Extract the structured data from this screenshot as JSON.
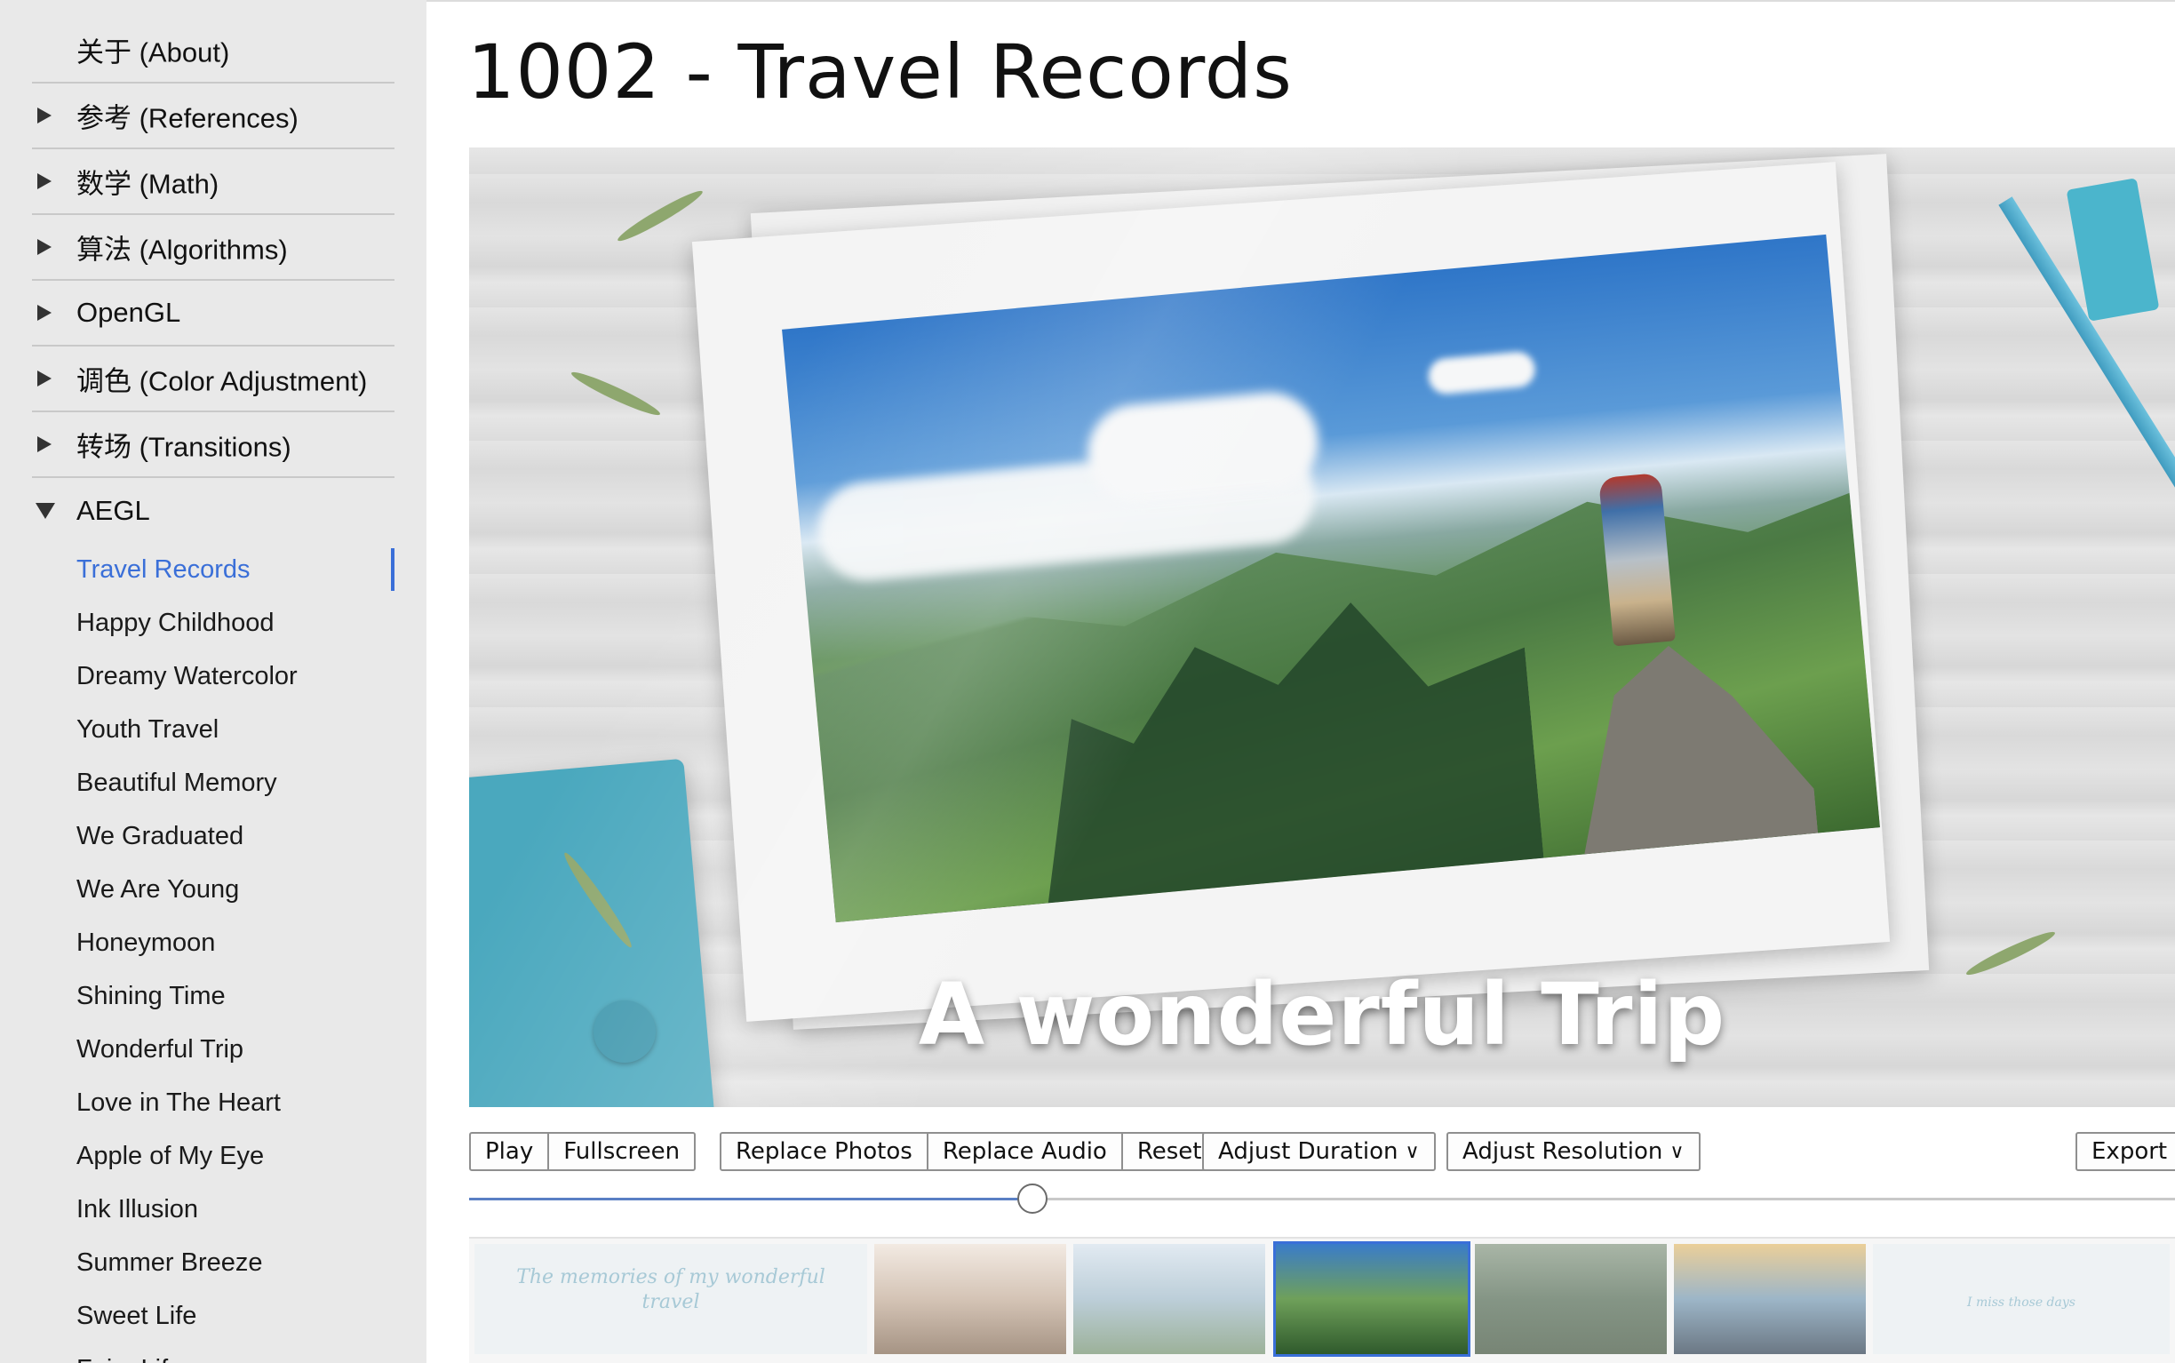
{
  "sidebar": {
    "categories": [
      {
        "label": "关于 (About)",
        "expandable": false
      },
      {
        "label": "参考 (References)",
        "expandable": true
      },
      {
        "label": "数学 (Math)",
        "expandable": true
      },
      {
        "label": "算法 (Algorithms)",
        "expandable": true
      },
      {
        "label": "OpenGL",
        "expandable": true
      },
      {
        "label": "调色 (Color Adjustment)",
        "expandable": true
      },
      {
        "label": "转场 (Transitions)",
        "expandable": true
      },
      {
        "label": "AEGL",
        "expandable": true,
        "expanded": true
      }
    ],
    "aegl_items": [
      "Travel Records",
      "Happy Childhood",
      "Dreamy Watercolor",
      "Youth Travel",
      "Beautiful Memory",
      "We Graduated",
      "We Are Young",
      "Honeymoon",
      "Shining Time",
      "Wonderful Trip",
      "Love in The Heart",
      "Apple of My Eye",
      "Ink Illusion",
      "Summer Breeze",
      "Sweet Life",
      "Fairy Life"
    ],
    "active_item": "Travel Records"
  },
  "main": {
    "title": "1002 - Travel Records",
    "preview_caption": "A wonderful Trip"
  },
  "toolbar": {
    "group1": [
      "Play",
      "Fullscreen"
    ],
    "group2": [
      "Replace Photos",
      "Replace Audio",
      "Reset"
    ],
    "adjust_duration": "Adjust Duration",
    "adjust_resolution": "Adjust Resolution",
    "export": "Export"
  },
  "slider": {
    "progress": 0.33
  },
  "thumbnails": {
    "selected_index": 3,
    "items": [
      {
        "type": "text",
        "text": "The memories of my wonderful travel"
      },
      {
        "type": "photo",
        "colors": [
          "#f1e6dc",
          "#c9b3a0",
          "#8b735e"
        ]
      },
      {
        "type": "photo",
        "colors": [
          "#dbe6f0",
          "#a9c1cf",
          "#7e9a7a"
        ]
      },
      {
        "type": "photo",
        "colors": [
          "#3a7cc9",
          "#6fa05a",
          "#2f5a2c"
        ]
      },
      {
        "type": "photo",
        "colors": [
          "#8fa08c",
          "#5f7560",
          "#4d5f4a"
        ]
      },
      {
        "type": "photo",
        "colors": [
          "#e7c27a",
          "#7fa0b8",
          "#3d4e5e"
        ]
      },
      {
        "type": "text_small",
        "text": "I miss those days"
      }
    ]
  },
  "colors": {
    "accent": "#3a6fd8",
    "sidebar_bg": "#e9e9e9"
  }
}
